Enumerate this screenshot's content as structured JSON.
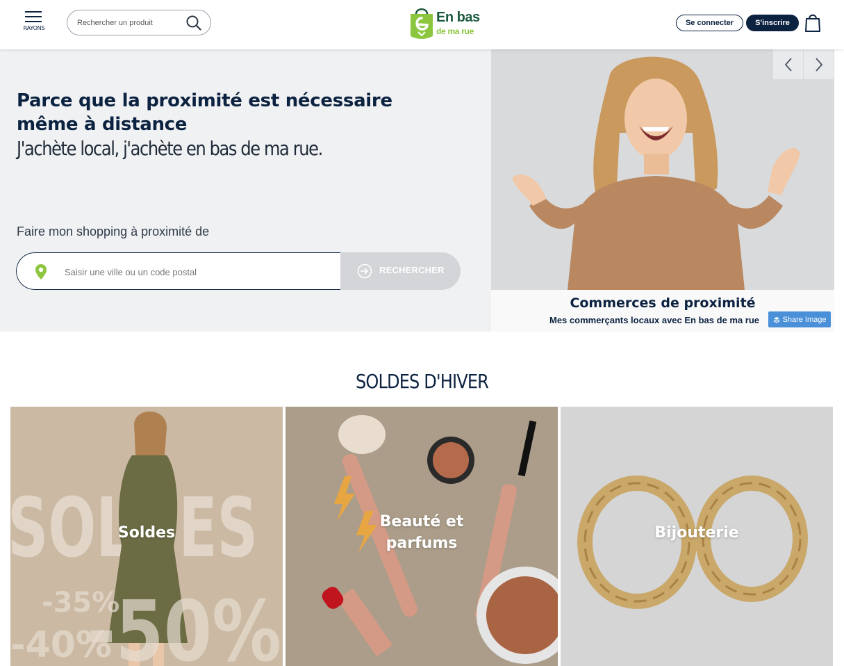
{
  "header": {
    "menu_label": "RAYONS",
    "search_placeholder": "Rechercher un produit",
    "logo_line1": "En bas",
    "logo_line2": "de ma rue",
    "login_label": "Se connecter",
    "signup_label": "S'inscrire"
  },
  "hero": {
    "title": "Parce que la proximité est nécessaire même à distance",
    "subtitle": "J'achète local, j'achète en bas de ma rue.",
    "proximity_label": "Faire mon shopping à proximité de",
    "location_placeholder": "Saisir une ville ou un code postal",
    "search_button": "RECHERCHER"
  },
  "slider": {
    "caption_title": "Commerces de proximité",
    "caption_text_pre": "Mes commerçants locaux avec ",
    "caption_text_bold": "En bas de ma rue",
    "share_label": "Share Image"
  },
  "section": {
    "title": "SOLDES D'HIVER",
    "cards": [
      {
        "label": "Soldes",
        "bg_text": "SOLDES",
        "promo_big": "-50%",
        "promo_small1": "-35%",
        "promo_small2": "-40%"
      },
      {
        "label": "Beauté et parfums"
      },
      {
        "label": "Bijouterie"
      }
    ]
  },
  "colors": {
    "navy": "#0b2240",
    "green": "#8cc63f",
    "hero_bg": "#f0f1f3",
    "button_grey": "#d3d5d8",
    "share_blue": "#4a90d9"
  }
}
